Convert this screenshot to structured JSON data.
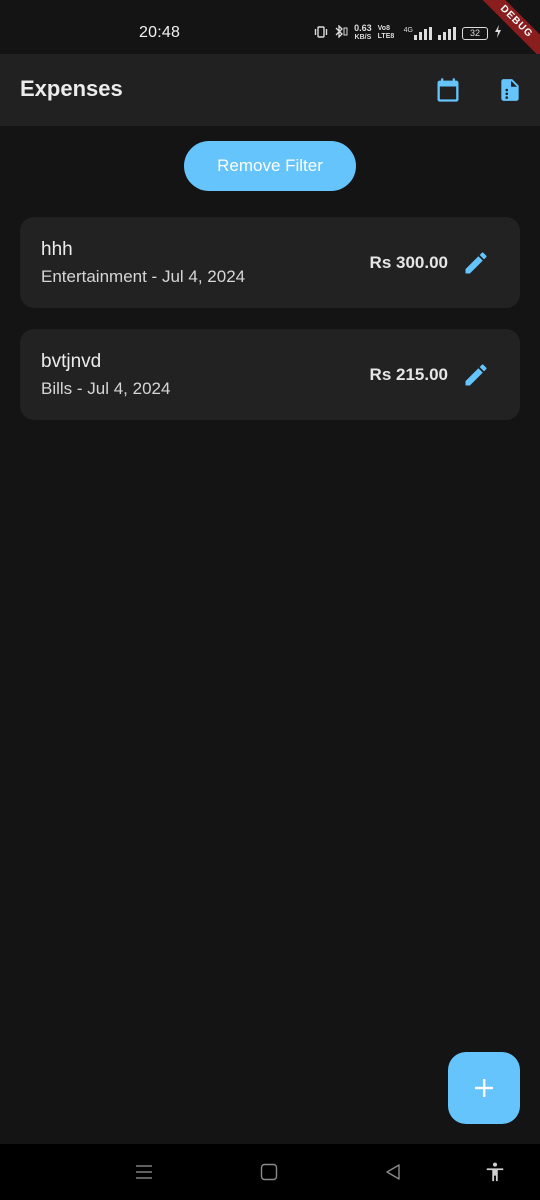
{
  "status_bar": {
    "time": "20:48",
    "net_speed_value": "0.63",
    "net_speed_unit": "KB/S",
    "network_tag": "Vo8 LTE8",
    "network_type": "4G",
    "battery_level": "32",
    "debug_label": "DEBUG"
  },
  "app_bar": {
    "title": "Expenses",
    "actions": [
      {
        "icon": "calendar-icon"
      },
      {
        "icon": "report-icon"
      }
    ]
  },
  "filter": {
    "remove_label": "Remove Filter"
  },
  "expenses": [
    {
      "name": "hhh",
      "subtitle": "Entertainment - Jul 4, 2024",
      "amount": "Rs 300.00",
      "edit_icon": "edit-icon"
    },
    {
      "name": "bvtjnvd",
      "subtitle": "Bills - Jul 4, 2024",
      "amount": "Rs 215.00",
      "edit_icon": "edit-icon"
    }
  ],
  "fab": {
    "icon": "plus-icon"
  },
  "nav_bar": {
    "icons": [
      "menu-icon",
      "home-square-icon",
      "back-triangle-icon",
      "accessibility-icon"
    ]
  },
  "colors": {
    "accent": "#64c4fb",
    "background": "#141414",
    "app_bar": "#212121",
    "card": "#222222",
    "debug_banner": "#8a1d1d"
  }
}
